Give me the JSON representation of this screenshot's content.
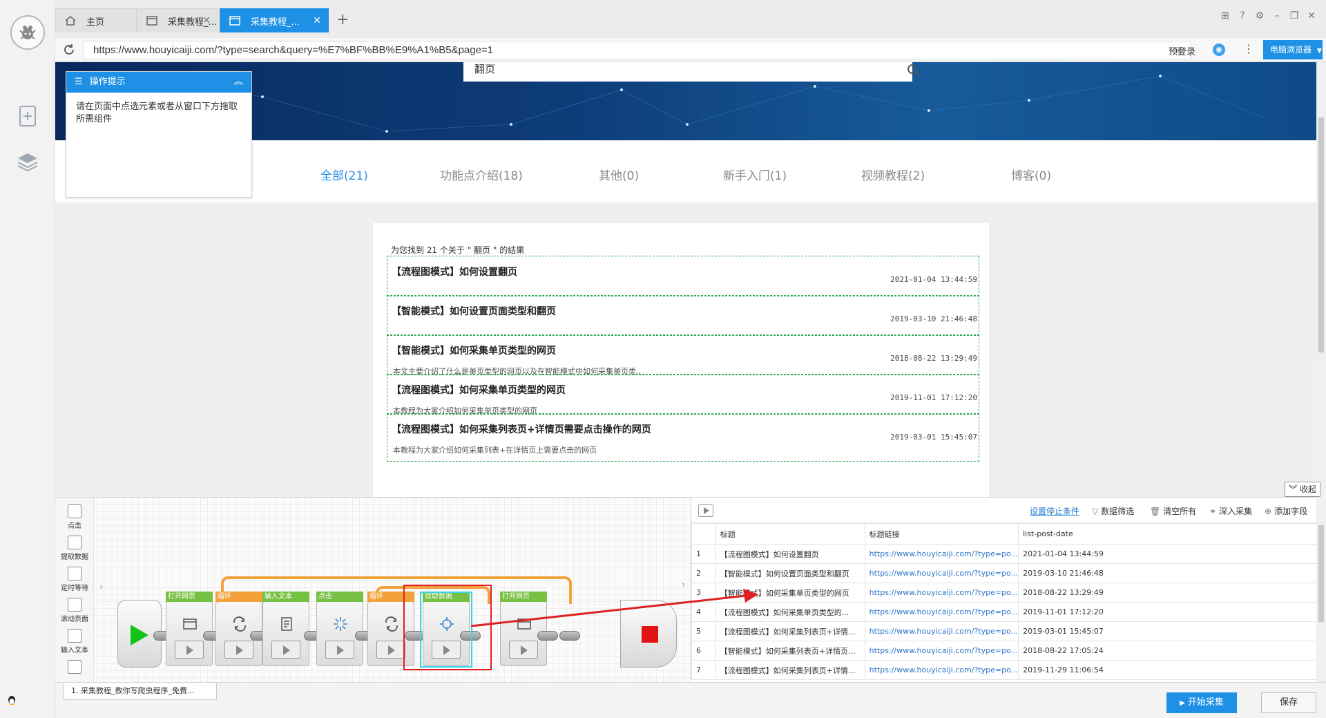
{
  "window": {
    "tabs": [
      {
        "label": "主页",
        "icon": "home-icon"
      },
      {
        "label": "采集教程_...",
        "icon": "page-icon"
      },
      {
        "label": "采集教程_...",
        "icon": "page-icon",
        "active": true
      }
    ]
  },
  "address_bar": {
    "url": "https://www.houyicaiji.com/?type=search&query=%E7%BF%BB%E9%A1%B5&page=1",
    "login_label": "预登录",
    "browser_button": "电脑浏览器"
  },
  "webpage": {
    "search_value": "翻页",
    "categories": [
      {
        "label": "全部(21)",
        "active": true
      },
      {
        "label": "功能点介绍(18)"
      },
      {
        "label": "其他(0)"
      },
      {
        "label": "新手入门(1)"
      },
      {
        "label": "视频教程(2)"
      },
      {
        "label": "博客(0)"
      }
    ],
    "result_summary": "为您找到 21 个关于 \" 翻页 \" 的结果",
    "results": [
      {
        "title": "【流程图模式】如何设置翻页",
        "date": "2021-01-04 13:44:59",
        "desc": ""
      },
      {
        "title": "【智能模式】如何设置页面类型和翻页",
        "date": "2019-03-10 21:46:48",
        "desc": ""
      },
      {
        "title": "【智能模式】如何采集单页类型的网页",
        "date": "2018-08-22 13:29:49",
        "desc": "本文主要介绍了什么是单页类型的网页以及在智能模式中如何采集单页类.."
      },
      {
        "title": "【流程图模式】如何采集单页类型的网页",
        "date": "2019-11-01 17:12:20",
        "desc": "本教程为大家介绍如何采集单页类型的网页"
      },
      {
        "title": "【流程图模式】如何采集列表页+详情页需要点击操作的网页",
        "date": "2019-03-01 15:45:07",
        "desc": "本教程为大家介绍如何采集列表+在详情页上需要点击的网页"
      }
    ]
  },
  "tip_panel": {
    "title": "操作提示",
    "text": "请在页面中点选元素或者从窗口下方拖取所需组件"
  },
  "collapse_label": "收起",
  "palette": [
    {
      "label": "点击",
      "icon": "click-icon"
    },
    {
      "label": "提取数据",
      "icon": "extract-icon"
    },
    {
      "label": "定时等待",
      "icon": "hourglass-icon"
    },
    {
      "label": "滚动页面",
      "icon": "scroll-icon"
    },
    {
      "label": "输入文本",
      "icon": "input-text-icon"
    },
    {
      "label": "",
      "icon": "more-icon"
    }
  ],
  "flow": {
    "steps": [
      {
        "label": "打开网页",
        "type": "action",
        "icon": "open-web-icon"
      },
      {
        "label": "循环",
        "type": "loop",
        "icon": "loop-icon"
      },
      {
        "label": "输入文本",
        "type": "action",
        "icon": "input-text-icon"
      },
      {
        "label": "点击",
        "type": "action",
        "icon": "click-icon"
      },
      {
        "label": "循环",
        "type": "loop",
        "icon": "loop-icon"
      },
      {
        "label": "提取数据",
        "type": "action",
        "icon": "extract-icon"
      },
      {
        "label": "打开网页",
        "type": "action",
        "icon": "open-web-icon"
      }
    ]
  },
  "data_panel": {
    "toolbar": {
      "stop_condition": "设置停止条件",
      "filter": "数据筛选",
      "clear": "清空所有",
      "deep": "深入采集",
      "add_field": "添加字段"
    },
    "columns": [
      "",
      "标题",
      "标题链接",
      "list-post-date"
    ],
    "rows": [
      [
        "1",
        "【流程图模式】如何设置翻页",
        "https://www.houyicaiji.com/?type=po...",
        "2021-01-04 13:44:59"
      ],
      [
        "2",
        "【智能模式】如何设置页面类型和翻页",
        "https://www.houyicaiji.com/?type=po...",
        "2019-03-10 21:46:48"
      ],
      [
        "3",
        "【智能模式】如何采集单页类型的网页",
        "https://www.houyicaiji.com/?type=po...",
        "2018-08-22 13:29:49"
      ],
      [
        "4",
        "【流程图模式】如何采集单页类型的...",
        "https://www.houyicaiji.com/?type=po...",
        "2019-11-01 17:12:20"
      ],
      [
        "5",
        "【流程图模式】如何采集列表页+详情...",
        "https://www.houyicaiji.com/?type=po...",
        "2019-03-01 15:45:07"
      ],
      [
        "6",
        "【智能模式】如何采集列表页+详情页...",
        "https://www.houyicaiji.com/?type=po...",
        "2018-08-22 17:05:24"
      ],
      [
        "7",
        "【流程图模式】如何采集列表页+详情...",
        "https://www.houyicaiji.com/?type=po...",
        "2019-11-29 11:06:54"
      ]
    ]
  },
  "bottom": {
    "task_tab": "1. 采集教程_教你写爬虫程序_免费...",
    "start_button": "开始采集",
    "save_button": "保存"
  },
  "colors": {
    "accent": "#1e90e6",
    "loop": "#f3a13a",
    "action": "#76c043",
    "start": "#12c316",
    "stop": "#e01414",
    "highlight": "#e02020"
  }
}
